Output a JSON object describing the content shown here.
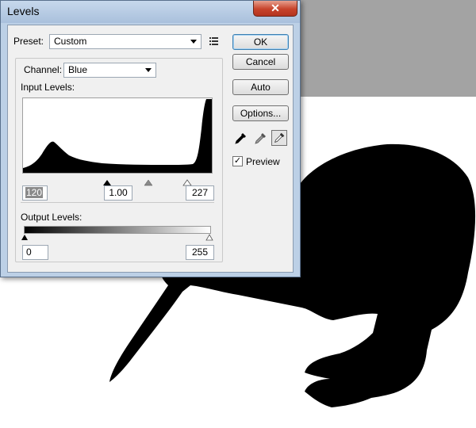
{
  "window": {
    "title": "Levels",
    "close_glyph": "✕"
  },
  "preset": {
    "label": "Preset:",
    "value": "Custom"
  },
  "channel": {
    "label": "Channel:",
    "value": "Blue"
  },
  "input_levels": {
    "label": "Input Levels:",
    "black": "120",
    "gamma": "1.00",
    "white": "227"
  },
  "output_levels": {
    "label": "Output Levels:",
    "black": "0",
    "white": "255"
  },
  "buttons": {
    "ok": "OK",
    "cancel": "Cancel",
    "auto": "Auto",
    "options": "Options..."
  },
  "preview": {
    "label": "Preview",
    "checked": true
  },
  "icons": [
    "preset-menu-icon",
    "black-eyedropper-icon",
    "gray-eyedropper-icon",
    "white-eyedropper-icon",
    "dropdown-arrow-icon",
    "close-icon",
    "checkmark-icon"
  ],
  "colors": {
    "title_bar": "#bcd0e6",
    "close_button": "#c7432b",
    "dialog_body": "#f0f0f0",
    "canvas_gray": "#a3a3a3"
  }
}
